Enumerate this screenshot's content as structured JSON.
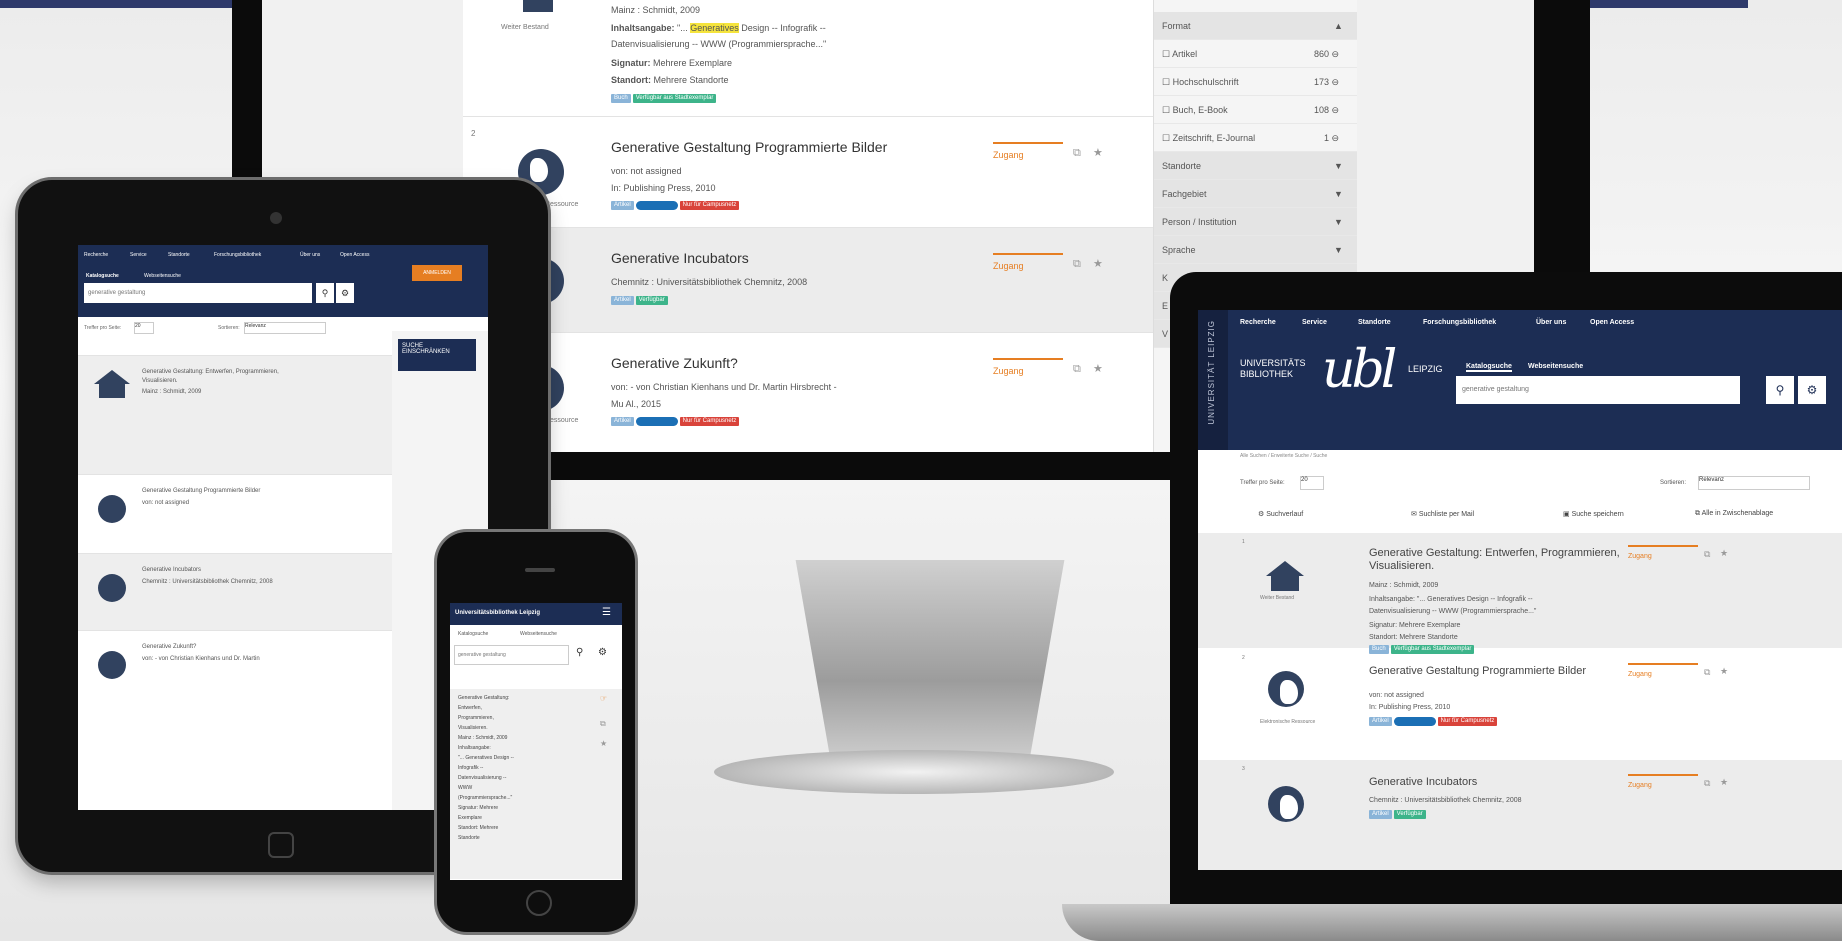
{
  "desktop": {
    "top_item": {
      "type_label": "Weiter Bestand",
      "meta_line1": "Mainz : Schmidt, 2009",
      "inhalt_label": "Inhaltsangabe:",
      "inhalt_pre": " \"... ",
      "inhalt_highlight": "Generatives",
      "inhalt_post": " Design -- Infografik --",
      "inhalt_line2": "Datenvisualisierung -- WWW (Programmiersprache...\"",
      "signatur_label": "Signatur:",
      "signatur_value": " Mehrere Exemplare",
      "standort_label": "Standort:",
      "standort_value": " Mehrere Standorte",
      "badges": [
        "Buch",
        "Verfügbar aus Stadtexemplar"
      ]
    },
    "items": [
      {
        "number": "2",
        "title": "Generative Gestaltung Programmierte Bilder",
        "line1": "von: not assigned",
        "line2": "In: Publishing Press, 2010",
        "type_label": "Elektronische Ressource",
        "badges": [
          "Artikel",
          "Nur für Campusnetz"
        ],
        "access": "Zugang"
      },
      {
        "number": "",
        "title": "Generative Incubators",
        "line1": "Chemnitz : Universitätsbibliothek Chemnitz, 2008",
        "line2": "",
        "type_label": "",
        "badges": [
          "Artikel",
          "Verfügbar"
        ],
        "access": "Zugang"
      },
      {
        "number": "",
        "title": "Generative Zukunft?",
        "line1": "von: - von Christian Kienhans und Dr. Martin Hirsbrecht -",
        "line2": "Mu Al., 2015",
        "type_label": "Elektronische Ressource",
        "badges": [
          "Artikel",
          "Nur für Campusnetz"
        ],
        "access": "Zugang"
      }
    ],
    "facets": [
      {
        "label": "Format",
        "count": "▲",
        "head": true
      },
      {
        "label": "☐ Artikel",
        "count": "860 ⊖",
        "head": false
      },
      {
        "label": "☐ Hochschulschrift",
        "count": "173 ⊖",
        "head": false
      },
      {
        "label": "☐ Buch, E-Book",
        "count": "108 ⊖",
        "head": false
      },
      {
        "label": "☐ Zeitschrift, E-Journal",
        "count": "1 ⊖",
        "head": false
      },
      {
        "label": "Standorte",
        "count": "▼",
        "head": false
      },
      {
        "label": "Fachgebiet",
        "count": "▼",
        "head": false
      },
      {
        "label": "Person / Institution",
        "count": "▼",
        "head": false
      },
      {
        "label": "Sprache",
        "count": "▼",
        "head": false
      },
      {
        "label": "K",
        "count": "",
        "head": false
      },
      {
        "label": "E",
        "count": "",
        "head": false
      },
      {
        "label": "V",
        "count": "",
        "head": false
      }
    ]
  },
  "tablet": {
    "nav": [
      "Recherche",
      "Service",
      "Standorte",
      "Forschungsbibliothek",
      "Über uns",
      "Open Access"
    ],
    "tabs": [
      "Katalogsuche",
      "Webseitensuche"
    ],
    "search_value": "generative gestaltung",
    "login": "ANMELDEN",
    "per_page_label": "Treffer pro Seite:",
    "per_page": "20",
    "sort_label": "Sortieren:",
    "sort_value": "Relevanz",
    "facet_title": "SUCHE EINSCHRÄNKEN",
    "items": [
      {
        "title": "Generative Gestaltung: Entwerfen, Programmieren, Visualisieren.",
        "meta": "Mainz : Schmidt, 2009"
      },
      {
        "title": "Generative Gestaltung Programmierte Bilder",
        "meta": "von: not assigned"
      },
      {
        "title": "Generative Incubators",
        "meta": "Chemnitz : Universitätsbibliothek Chemnitz, 2008"
      },
      {
        "title": "Generative Zukunft?",
        "meta": "von: - von Christian Kienhans und Dr. Martin"
      }
    ]
  },
  "phone": {
    "title": "Universitätsbibliothek Leipzig",
    "tabs": [
      "Katalogsuche",
      "Webseitensuche"
    ],
    "search_value": "generative gestaltung",
    "item_lines": [
      "Generative Gestaltung:",
      "Entwerfen,",
      "Programmieren,",
      "Visualisieren.",
      "Mainz : Schmidt, 2009",
      "Inhaltsangabe:",
      "\"... Generatives Design --",
      "Infografik --",
      "Datenvisualisierung --",
      "WWW",
      "(Programmiersprache...\"",
      "Signatur: Mehrere",
      "Exemplare",
      "Standort: Mehrere",
      "Standorte"
    ]
  },
  "laptop": {
    "vertical_label": "UNIVERSITÄT LEIPZIG",
    "nav": [
      "Recherche",
      "Service",
      "Standorte",
      "Forschungsbibliothek",
      "Über uns",
      "Open Access"
    ],
    "logo_left1": "UNIVERSITÄTS",
    "logo_left2": "BIBLIOTHEK",
    "logo_mark": "ubl",
    "logo_right": "LEIPZIG",
    "tabs": [
      "Katalogsuche",
      "Webseitensuche"
    ],
    "search_value": "generative gestaltung",
    "breadcrumb": "Alle Suchen / Erweiterte Suche / Suche",
    "per_page_label": "Treffer pro Seite:",
    "per_page": "20",
    "sort_label": "Sortieren:",
    "sort_value": "Relevanz",
    "toolbar": [
      "Suchverlauf",
      "Suchliste per Mail",
      "Suche speichern",
      "Alle in Zwischenablage"
    ],
    "items": [
      {
        "number": "1",
        "title": "Generative Gestaltung: Entwerfen, Programmieren,",
        "title2": "Visualisieren.",
        "type_label": "Weiter Bestand",
        "lines": [
          "Mainz : Schmidt, 2009",
          "Inhaltsangabe: \"... Generatives Design -- Infografik --",
          "Datenvisualisierung -- WWW (Programmiersprache...\"",
          "Signatur: Mehrere Exemplare",
          "Standort: Mehrere Standorte"
        ],
        "badges": [
          "Buch",
          "Verfügbar aus Stadtexemplar"
        ],
        "access": "Zugang"
      },
      {
        "number": "2",
        "title": "Generative Gestaltung Programmierte Bilder",
        "title2": "",
        "type_label": "Elektronische Ressource",
        "lines": [
          "von: not assigned",
          "In: Publishing Press, 2010"
        ],
        "badges": [
          "Artikel",
          "Nur für Campusnetz"
        ],
        "access": "Zugang"
      },
      {
        "number": "3",
        "title": "Generative Incubators",
        "title2": "",
        "type_label": "",
        "lines": [
          "Chemnitz : Universitätsbibliothek Chemnitz, 2008"
        ],
        "badges": [
          "Artikel",
          "Verfügbar"
        ],
        "access": "Zugang"
      }
    ]
  },
  "colors": {
    "navy": "#1c2d54",
    "accent_orange": "#e67e22",
    "badge_green": "#3db48a",
    "badge_red": "#d9433a",
    "highlight": "#f5e43d"
  }
}
